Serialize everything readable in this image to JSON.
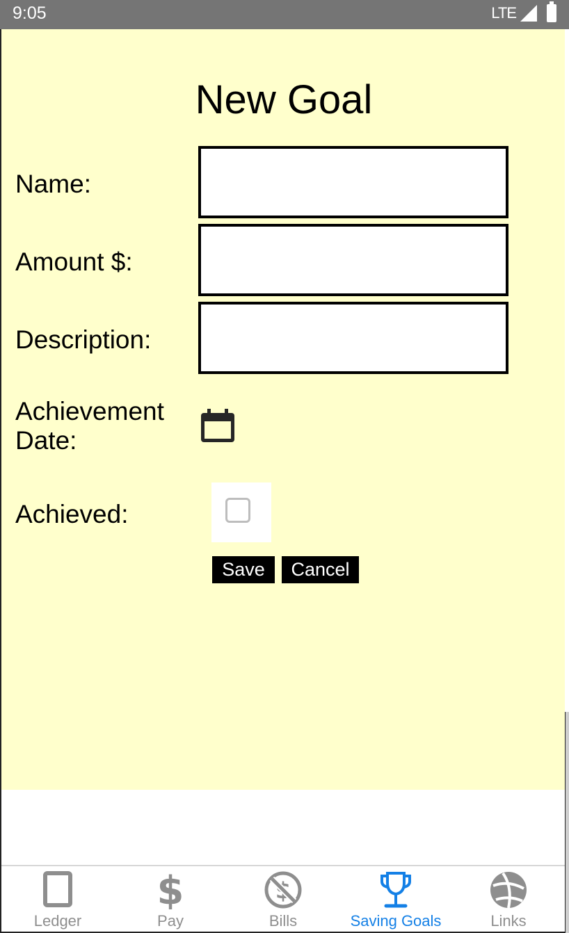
{
  "status_bar": {
    "time": "9:05",
    "network": "LTE"
  },
  "page": {
    "title": "New Goal",
    "background": "#ffffcc"
  },
  "form": {
    "fields": [
      {
        "label": "Name:",
        "value": "",
        "placeholder": ""
      },
      {
        "label": "Amount $:",
        "value": "",
        "placeholder": ""
      },
      {
        "label": "Description:",
        "value": "",
        "placeholder": ""
      }
    ],
    "achievement_date": {
      "label_line1": "Achievement",
      "label_line2": "Date:",
      "icon": "calendar-icon"
    },
    "achieved": {
      "label": "Achieved:",
      "checked": false
    },
    "save_label": "Save",
    "cancel_label": "Cancel"
  },
  "tab_bar": {
    "active_color": "#1480e6",
    "inactive_color": "#8e8e8e",
    "items": [
      {
        "label": "Ledger",
        "icon": "tablet-icon",
        "active": false
      },
      {
        "label": "Pay",
        "icon": "dollar-icon",
        "active": false
      },
      {
        "label": "Bills",
        "icon": "no-dollar-icon",
        "active": false
      },
      {
        "label": "Saving Goals",
        "icon": "trophy-icon",
        "active": true
      },
      {
        "label": "Links",
        "icon": "globe-icon",
        "active": false
      }
    ]
  }
}
